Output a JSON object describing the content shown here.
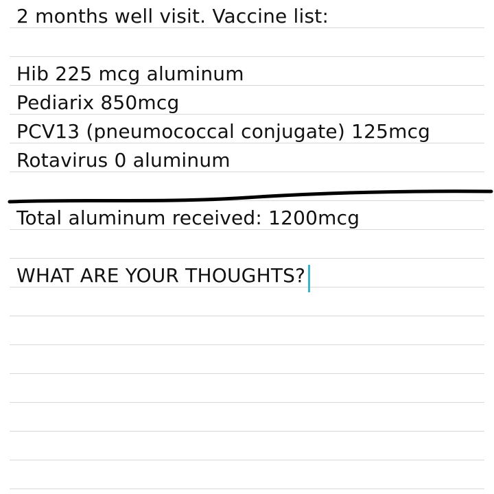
{
  "note": {
    "lines": [
      "2 months well visit. Vaccine list:",
      "",
      "Hib 225 mcg aluminum",
      "Pediarix 850mcg",
      "PCV13 (pneumococcal conjugate) 125mcg",
      "Rotavirus 0 aluminum",
      "",
      "Total aluminum received: 1200mcg",
      "",
      "WHAT ARE YOUR THOUGHTS?"
    ]
  },
  "colors": {
    "ink": "#111111",
    "ruled_line": "#d8d8d8",
    "cursor": "#3ab4c6",
    "divider": "#000000"
  }
}
